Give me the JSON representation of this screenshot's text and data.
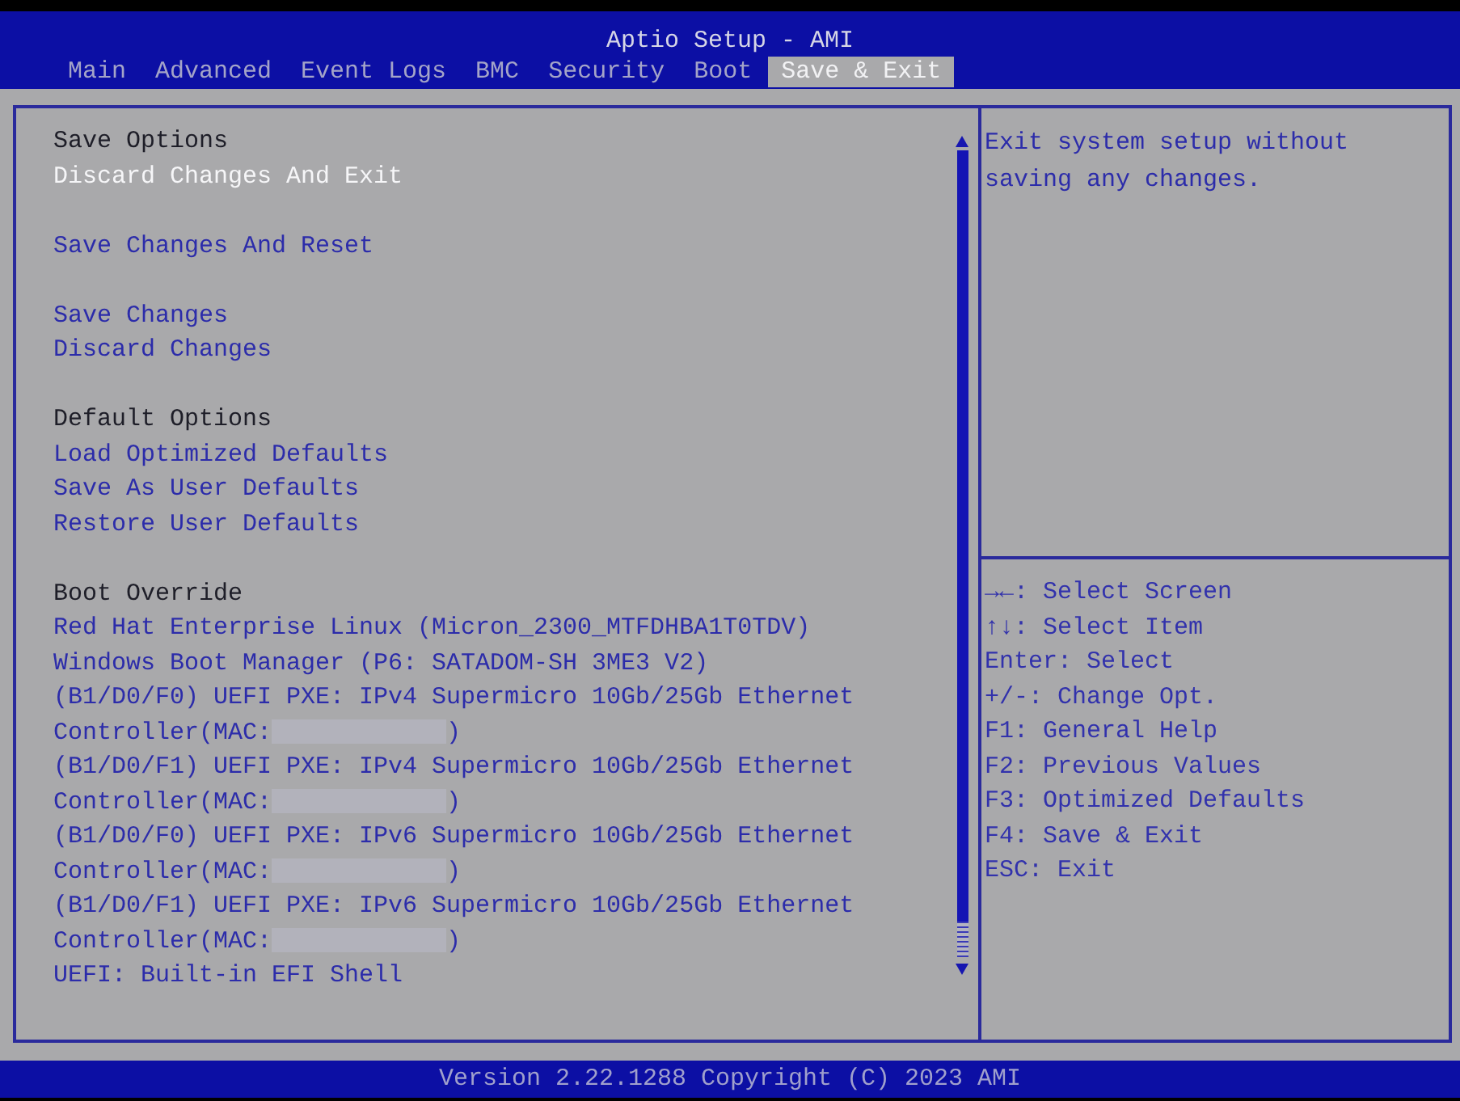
{
  "window": {
    "title": "Aptio Setup - AMI"
  },
  "tabs": [
    {
      "label": "Main",
      "selected": false
    },
    {
      "label": "Advanced",
      "selected": false
    },
    {
      "label": "Event Logs",
      "selected": false
    },
    {
      "label": "BMC",
      "selected": false
    },
    {
      "label": "Security",
      "selected": false
    },
    {
      "label": "Boot",
      "selected": false
    },
    {
      "label": "Save & Exit",
      "selected": true
    }
  ],
  "menu": {
    "sections": [
      {
        "heading": "Save Options",
        "groups": [
          [
            {
              "label": "Discard Changes And Exit",
              "selected": true
            }
          ],
          [
            {
              "label": "Save Changes And Reset",
              "selected": false
            }
          ],
          [
            {
              "label": "Save Changes",
              "selected": false
            },
            {
              "label": "Discard Changes",
              "selected": false
            }
          ]
        ]
      },
      {
        "heading": "Default Options",
        "groups": [
          [
            {
              "label": "Load Optimized Defaults",
              "selected": false
            },
            {
              "label": "Save As User Defaults",
              "selected": false
            },
            {
              "label": "Restore User Defaults",
              "selected": false
            }
          ]
        ]
      },
      {
        "heading": "Boot Override",
        "groups": [
          [
            {
              "label": "Red Hat Enterprise Linux (Micron_2300_MTFDHBA1T0TDV)",
              "selected": false,
              "redacted": false
            },
            {
              "label": "Windows Boot Manager (P6: SATADOM-SH 3ME3 V2)",
              "selected": false,
              "redacted": false
            },
            {
              "label": "(B1/D0/F0) UEFI PXE: IPv4 Supermicro 10Gb/25Gb Ethernet Controller(MAC:",
              "label_end": ")",
              "selected": false,
              "redacted": true
            },
            {
              "label": "(B1/D0/F1) UEFI PXE: IPv4 Supermicro 10Gb/25Gb Ethernet Controller(MAC:",
              "label_end": ")",
              "selected": false,
              "redacted": true
            },
            {
              "label": "(B1/D0/F0) UEFI PXE: IPv6 Supermicro 10Gb/25Gb Ethernet Controller(MAC:",
              "label_end": ")",
              "selected": false,
              "redacted": true
            },
            {
              "label": "(B1/D0/F1) UEFI PXE: IPv6 Supermicro 10Gb/25Gb Ethernet Controller(MAC:",
              "label_end": ")",
              "selected": false,
              "redacted": true
            },
            {
              "label": "UEFI: Built-in EFI Shell",
              "selected": false,
              "redacted": false
            }
          ]
        ]
      }
    ]
  },
  "help": {
    "text": "Exit system setup without saving any changes.",
    "keys": [
      "→←: Select Screen",
      "↑↓: Select Item",
      "Enter: Select",
      "+/-: Change Opt.",
      "F1: General Help",
      "F2: Previous Values",
      "F3: Optimized Defaults",
      "F4: Save & Exit",
      "ESC: Exit"
    ]
  },
  "footer": {
    "text": "Version 2.22.1288 Copyright (C) 2023 AMI"
  }
}
